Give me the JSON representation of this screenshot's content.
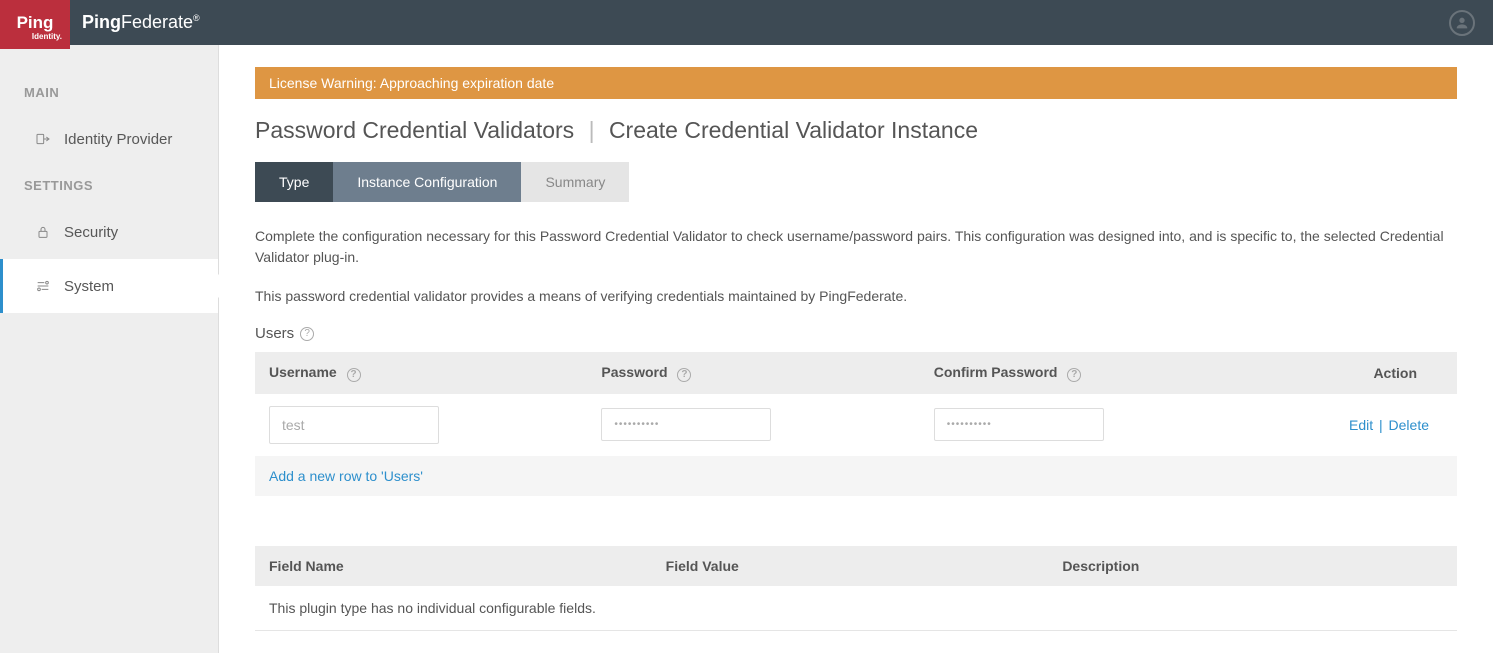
{
  "header": {
    "logo_main": "Ping",
    "logo_sub": "Identity.",
    "product": "PingFederate"
  },
  "sidebar": {
    "section_main": "MAIN",
    "section_settings": "SETTINGS",
    "items": {
      "idp": "Identity Provider",
      "security": "Security",
      "system": "System"
    }
  },
  "warning": "License Warning: Approaching expiration date",
  "breadcrumb": {
    "parent": "Password Credential Validators",
    "current": "Create Credential Validator Instance"
  },
  "tabs": {
    "type": "Type",
    "instance": "Instance Configuration",
    "summary": "Summary"
  },
  "description1": "Complete the configuration necessary for this Password Credential Validator to check username/password pairs. This configuration was designed into, and is specific to, the selected Credential Validator plug-in.",
  "description2": "This password credential validator provides a means of verifying credentials maintained by PingFederate.",
  "users": {
    "label": "Users",
    "columns": {
      "username": "Username",
      "password": "Password",
      "confirm": "Confirm Password",
      "action": "Action"
    },
    "row": {
      "username": "test",
      "password_mask": "••••••••••",
      "confirm_mask": "••••••••••"
    },
    "actions": {
      "edit": "Edit",
      "delete": "Delete"
    },
    "add_row": "Add a new row to 'Users'"
  },
  "fields": {
    "columns": {
      "name": "Field Name",
      "value": "Field Value",
      "desc": "Description"
    },
    "empty_msg": "This plugin type has no individual configurable fields."
  }
}
